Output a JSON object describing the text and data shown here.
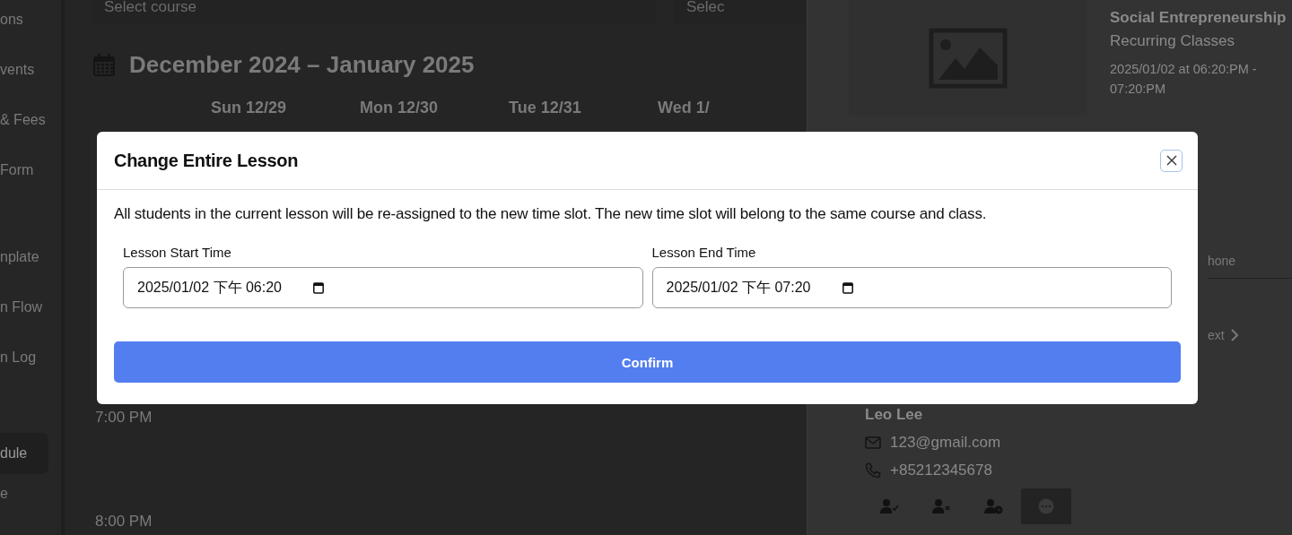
{
  "sidebar": {
    "items": [
      {
        "label": "ons",
        "selected": false
      },
      {
        "label": "vents",
        "selected": false
      },
      {
        "label": "& Fees",
        "selected": false
      },
      {
        "label": "Form",
        "selected": false
      },
      {
        "label": "nplate",
        "selected": false
      },
      {
        "label": "n Flow",
        "selected": false
      },
      {
        "label": "n Log",
        "selected": false
      },
      {
        "label": "dule",
        "selected": true
      },
      {
        "label": "e",
        "selected": false
      }
    ]
  },
  "filters": [
    {
      "placeholder": "Select course"
    },
    {
      "placeholder": "Selec"
    }
  ],
  "calendar": {
    "title": "December 2024 – January 2025",
    "days": [
      "Sun 12/29",
      "Mon 12/30",
      "Tue 12/31",
      "Wed 1/"
    ],
    "times": [
      "7:00 PM",
      "8:00 PM"
    ]
  },
  "details": {
    "course": "Social Entrepreneurship",
    "type": "Recurring Classes",
    "time_lines": [
      "2025/01/02 at 06:20:PM -",
      "07:20:PM"
    ],
    "tab_partial": "hone",
    "next_partial": "ext",
    "student": {
      "name": "Leo Lee",
      "email": "123@gmail.com",
      "phone": "+85212345678"
    },
    "actions": [
      {
        "kind": "check",
        "selected": false
      },
      {
        "kind": "cross",
        "selected": false
      },
      {
        "kind": "clock",
        "selected": false
      },
      {
        "kind": "more",
        "selected": true
      }
    ]
  },
  "dialog": {
    "title": "Change Entire Lesson",
    "message": "All students in the current lesson will be re-assigned to the new time slot. The new time slot will belong to the same course and class.",
    "fields": [
      {
        "label": "Lesson Start Time",
        "value": "2025/01/02 下午 06:20"
      },
      {
        "label": "Lesson End Time",
        "value": "2025/01/02 下午 07:20"
      }
    ],
    "confirm": "Confirm"
  }
}
